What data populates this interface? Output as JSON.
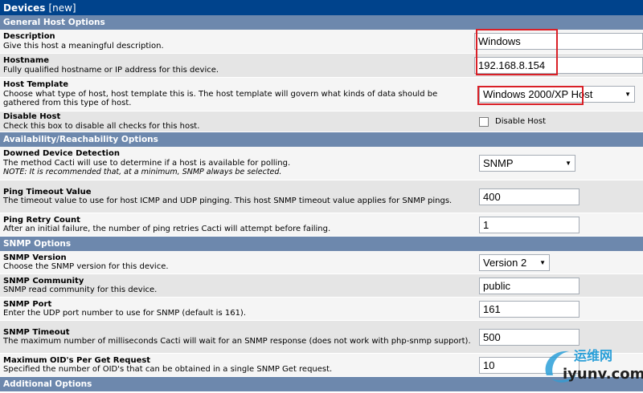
{
  "title": {
    "main": "Devices",
    "sub": "[new]"
  },
  "sections": {
    "general": "General Host Options",
    "availability": "Availability/Reachability Options",
    "snmp": "SNMP Options",
    "additional": "Additional Options"
  },
  "fields": {
    "description": {
      "label": "Description",
      "help": "Give this host a meaningful description.",
      "value": "Windows"
    },
    "hostname": {
      "label": "Hostname",
      "help": "Fully qualified hostname or IP address for this device.",
      "value": "192.168.8.154"
    },
    "host_template": {
      "label": "Host Template",
      "help": "Choose what type of host, host template this is. The host template will govern what kinds of data should be gathered from this type of host.",
      "value": "Windows 2000/XP Host"
    },
    "disable_host": {
      "label": "Disable Host",
      "help": "Check this box to disable all checks for this host.",
      "checkbox_label": "Disable Host",
      "checked": false
    },
    "downed_detection": {
      "label": "Downed Device Detection",
      "help": "The method Cacti will use to determine if a host is available for polling.",
      "note": "NOTE: It is recommended that, at a minimum, SNMP always be selected.",
      "value": "SNMP"
    },
    "ping_timeout": {
      "label": "Ping Timeout Value",
      "help": "The timeout value to use for host ICMP and UDP pinging. This host SNMP timeout value applies for SNMP pings.",
      "value": "400"
    },
    "ping_retry": {
      "label": "Ping Retry Count",
      "help": "After an initial failure, the number of ping retries Cacti will attempt before failing.",
      "value": "1"
    },
    "snmp_version": {
      "label": "SNMP Version",
      "help": "Choose the SNMP version for this device.",
      "value": "Version 2"
    },
    "snmp_community": {
      "label": "SNMP Community",
      "help": "SNMP read community for this device.",
      "value": "public"
    },
    "snmp_port": {
      "label": "SNMP Port",
      "help": "Enter the UDP port number to use for SNMP (default is 161).",
      "value": "161"
    },
    "snmp_timeout": {
      "label": "SNMP Timeout",
      "help": "The maximum number of milliseconds Cacti will wait for an SNMP response (does not work with php-snmp support).",
      "value": "500"
    },
    "max_oids": {
      "label": "Maximum OID's Per Get Request",
      "help": "Specified the number of OID's that can be obtained in a single SNMP Get request.",
      "value": "10"
    }
  },
  "watermark": {
    "cn": "运维网",
    "en": "iyunv.com"
  },
  "colors": {
    "title_bg": "#00438c",
    "section_bg": "#6d88ad",
    "highlight": "#d92027"
  }
}
